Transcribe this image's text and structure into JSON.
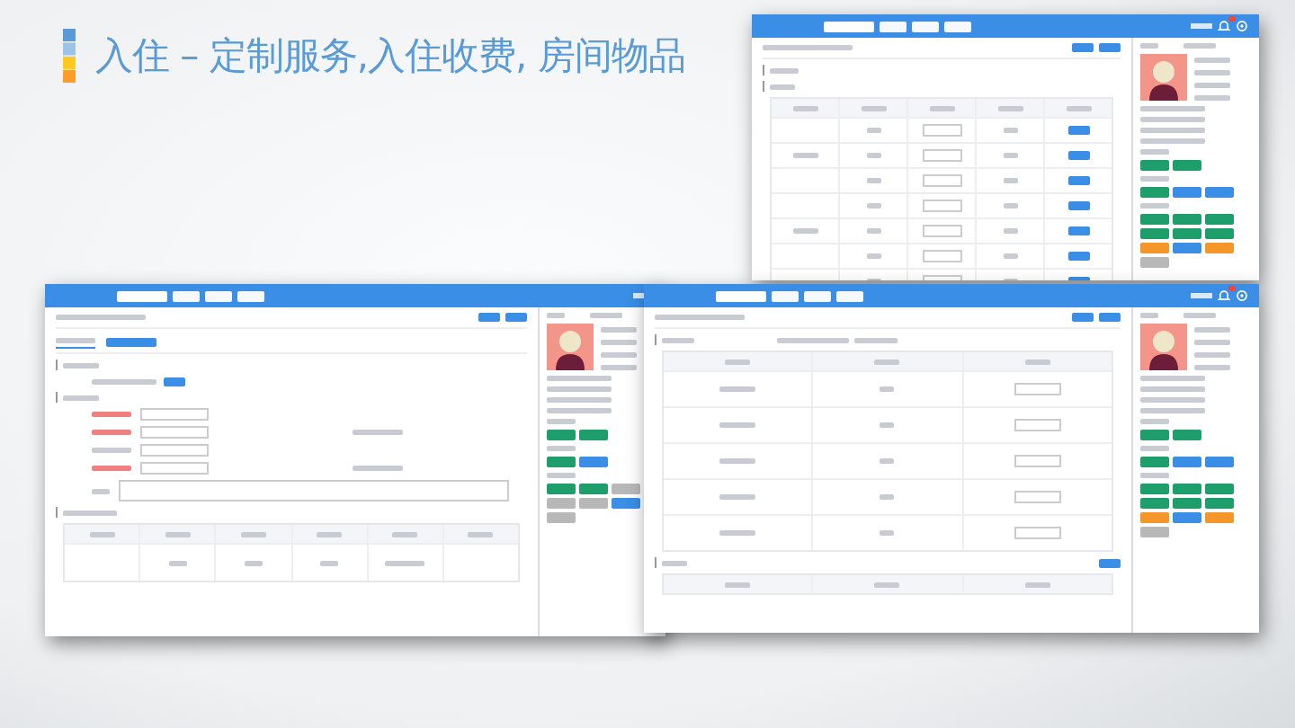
{
  "slide": {
    "title": "入住 – 定制服务,入住收费, 房间物品"
  },
  "windows": [
    {
      "kind": "room-items",
      "notification": true,
      "panel_groups": [
        [
          {
            "color": "#1e9e6a"
          },
          {
            "color": "#1e9e6a"
          }
        ],
        [
          {
            "color": "#1e9e6a"
          },
          {
            "color": "#3a8ee6"
          },
          {
            "color": "#3a8ee6"
          }
        ],
        [
          {
            "color": "#1e9e6a"
          },
          {
            "color": "#1e9e6a"
          },
          {
            "color": "#1e9e6a"
          },
          {
            "color": "#1e9e6a"
          },
          {
            "color": "#1e9e6a"
          },
          {
            "color": "#1e9e6a"
          },
          {
            "color": "#f5962a"
          },
          {
            "color": "#3a8ee6"
          },
          {
            "color": "#f5962a"
          },
          {
            "color": "#b8b8b8"
          }
        ]
      ]
    },
    {
      "kind": "custom-service",
      "panel_groups": [
        [
          {
            "color": "#1e9e6a"
          },
          {
            "color": "#1e9e6a"
          }
        ],
        [
          {
            "color": "#1e9e6a"
          },
          {
            "color": "#3a8ee6"
          }
        ],
        [
          {
            "color": "#1e9e6a"
          },
          {
            "color": "#1e9e6a"
          },
          {
            "color": "#b8b8b8"
          },
          {
            "color": "#b8b8b8"
          },
          {
            "color": "#b8b8b8"
          },
          {
            "color": "#3a8ee6"
          },
          {
            "color": "#b8b8b8"
          }
        ]
      ]
    },
    {
      "kind": "fees",
      "notification": true,
      "panel_groups": [
        [
          {
            "color": "#1e9e6a"
          },
          {
            "color": "#1e9e6a"
          }
        ],
        [
          {
            "color": "#1e9e6a"
          },
          {
            "color": "#3a8ee6"
          },
          {
            "color": "#3a8ee6"
          }
        ],
        [
          {
            "color": "#1e9e6a"
          },
          {
            "color": "#1e9e6a"
          },
          {
            "color": "#1e9e6a"
          },
          {
            "color": "#1e9e6a"
          },
          {
            "color": "#1e9e6a"
          },
          {
            "color": "#1e9e6a"
          },
          {
            "color": "#f5962a"
          },
          {
            "color": "#3a8ee6"
          },
          {
            "color": "#f5962a"
          },
          {
            "color": "#b8b8b8"
          }
        ]
      ]
    }
  ]
}
